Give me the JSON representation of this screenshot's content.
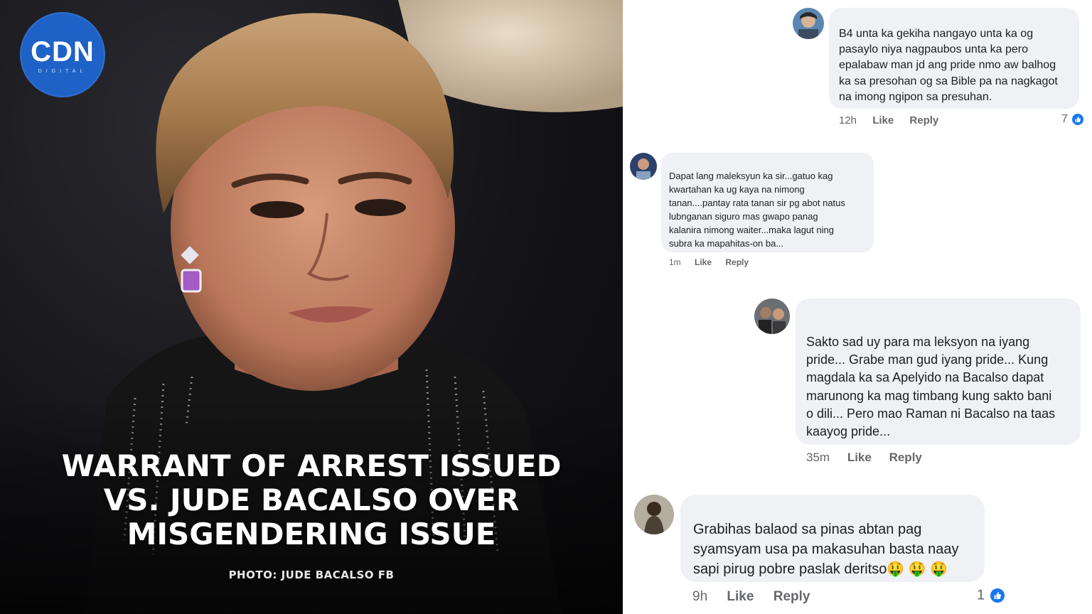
{
  "brand": {
    "logo_text": "CDN",
    "logo_sub": "DIGITAL"
  },
  "article": {
    "headline_lines": [
      "WARRANT OF ARREST ISSUED",
      "VS. JUDE BACALSO OVER",
      "MISGENDERING ISSUE"
    ],
    "photo_credit": "PHOTO: JUDE BACALSO FB"
  },
  "comments": [
    {
      "lines": [
        "B4 unta ka gekiha nangayo unta ka og",
        "pasaylo niya nagpaubos unta ka pero",
        "epalabaw man jd ang pride nmo aw balhog",
        "ka sa presohan og sa Bible pa na nagkagot",
        "na imong ngipon sa presuhan."
      ],
      "time": "12h",
      "like_label": "Like",
      "reply_label": "Reply",
      "reactions": "7"
    },
    {
      "lines": [
        "Dapat lang maleksyun ka sir...gatuo kag",
        "kwartahan ka ug kaya na nimong",
        "tanan....pantay rata tanan sir pg abot natus",
        "lubnganan siguro mas gwapo panag",
        "kalanira nimong waiter...maka lagut ning",
        "subra ka mapahitas-on ba..."
      ],
      "time": "1m",
      "like_label": "Like",
      "reply_label": "Reply"
    },
    {
      "lines": [
        "Sakto sad uy para ma leksyon na iyang",
        "pride... Grabe man gud iyang pride... Kung",
        "magdala ka sa Apelyido na Bacalso dapat",
        "marunong ka mag timbang kung sakto bani",
        "o dili... Pero mao Raman ni Bacalso na taas",
        "kaayog pride..."
      ],
      "time": "35m",
      "like_label": "Like",
      "reply_label": "Reply"
    },
    {
      "lines": [
        "Grabihas balaod sa pinas abtan pag",
        "syamsyam usa pa makasuhan basta naay",
        "sapi pirug pobre paslak deritso🤑 🤑 🤑"
      ],
      "time": "9h",
      "like_label": "Like",
      "reply_label": "Reply",
      "reactions": "1"
    }
  ],
  "colors": {
    "logo_blue": "#1f62c7",
    "bubble_bg": "#eff1f4",
    "meta_gray": "#65676b",
    "like_blue": "#1877f2"
  },
  "icons": [
    "like-reaction-icon",
    "avatar-photo"
  ]
}
